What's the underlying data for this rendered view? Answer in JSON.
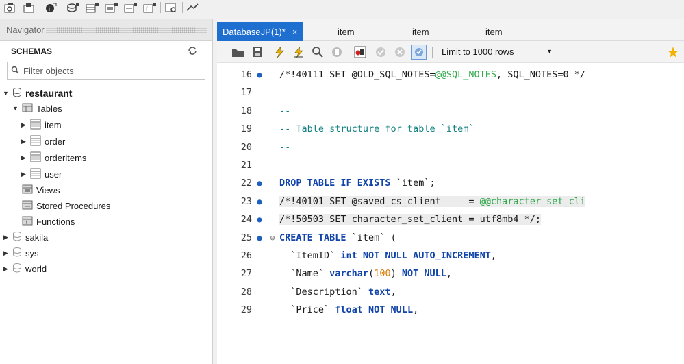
{
  "navigator": {
    "title": "Navigator",
    "schemas_label": "SCHEMAS",
    "filter_placeholder": "Filter objects",
    "tree": [
      {
        "label": "restaurant",
        "level": "db",
        "expanded": true
      },
      {
        "label": "Tables",
        "level": "folder",
        "expanded": true
      },
      {
        "label": "item",
        "level": "table"
      },
      {
        "label": "order",
        "level": "table"
      },
      {
        "label": "orderitems",
        "level": "table"
      },
      {
        "label": "user",
        "level": "table"
      },
      {
        "label": "Views",
        "level": "folder"
      },
      {
        "label": "Stored Procedures",
        "level": "folder"
      },
      {
        "label": "Functions",
        "level": "folder"
      },
      {
        "label": "sakila",
        "level": "db"
      },
      {
        "label": "sys",
        "level": "db"
      },
      {
        "label": "world",
        "level": "db"
      }
    ]
  },
  "tabs": [
    {
      "label": "DatabaseJP(1)*",
      "active": true,
      "close": "×"
    },
    {
      "label": "item"
    },
    {
      "label": "item"
    },
    {
      "label": "item"
    }
  ],
  "sql_toolbar": {
    "limit_label": "Limit to 1000 rows"
  },
  "code_lines": [
    {
      "n": "16",
      "dot": "●",
      "fold": "",
      "highlight": false,
      "tokens": [
        [
          "c",
          "/*!40111 SET @OLD_SQL_NOTES="
        ],
        [
          "v",
          "@@SQL_NOTES"
        ],
        [
          "c",
          ", SQL_NOTES=0 */"
        ]
      ]
    },
    {
      "n": "17",
      "dot": "",
      "fold": "",
      "highlight": false,
      "tokens": []
    },
    {
      "n": "18",
      "dot": "",
      "fold": "",
      "highlight": false,
      "tokens": [
        [
          "cm",
          "--"
        ]
      ]
    },
    {
      "n": "19",
      "dot": "",
      "fold": "",
      "highlight": false,
      "tokens": [
        [
          "cm",
          "-- Table structure for table `item`"
        ]
      ]
    },
    {
      "n": "20",
      "dot": "",
      "fold": "",
      "highlight": false,
      "tokens": [
        [
          "cm",
          "--"
        ]
      ]
    },
    {
      "n": "21",
      "dot": "",
      "fold": "",
      "highlight": false,
      "tokens": []
    },
    {
      "n": "22",
      "dot": "●",
      "fold": "",
      "highlight": false,
      "tokens": [
        [
          "k",
          "DROP TABLE IF EXISTS"
        ],
        [
          "s",
          " `item`;"
        ]
      ]
    },
    {
      "n": "23",
      "dot": "●",
      "fold": "",
      "highlight": true,
      "tokens": [
        [
          "c",
          "/*!40101 SET @saved_cs_client     = "
        ],
        [
          "v",
          "@@character_set_cli"
        ]
      ]
    },
    {
      "n": "24",
      "dot": "●",
      "fold": "",
      "highlight": true,
      "tokens": [
        [
          "c",
          "/*!50503 SET character_set_client = utf8mb4 */;"
        ]
      ]
    },
    {
      "n": "25",
      "dot": "●",
      "fold": "⊖",
      "highlight": false,
      "tokens": [
        [
          "k",
          "CREATE TABLE"
        ],
        [
          "s",
          " `item` ("
        ]
      ]
    },
    {
      "n": "26",
      "dot": "",
      "fold": "",
      "highlight": false,
      "tokens": [
        [
          "s",
          "  `ItemID` "
        ],
        [
          "k",
          "int NOT NULL AUTO_INCREMENT"
        ],
        [
          "s",
          ","
        ]
      ]
    },
    {
      "n": "27",
      "dot": "",
      "fold": "",
      "highlight": false,
      "tokens": [
        [
          "s",
          "  `Name` "
        ],
        [
          "k",
          "varchar"
        ],
        [
          "s",
          "("
        ],
        [
          "n",
          "100"
        ],
        [
          "s",
          ") "
        ],
        [
          "k",
          "NOT NULL"
        ],
        [
          "s",
          ","
        ]
      ]
    },
    {
      "n": "28",
      "dot": "",
      "fold": "",
      "highlight": false,
      "tokens": [
        [
          "s",
          "  `Description` "
        ],
        [
          "k",
          "text"
        ],
        [
          "s",
          ","
        ]
      ]
    },
    {
      "n": "29",
      "dot": "",
      "fold": "",
      "highlight": false,
      "tokens": [
        [
          "s",
          "  `Price` "
        ],
        [
          "k",
          "float NOT NULL"
        ],
        [
          "s",
          ","
        ]
      ]
    }
  ]
}
